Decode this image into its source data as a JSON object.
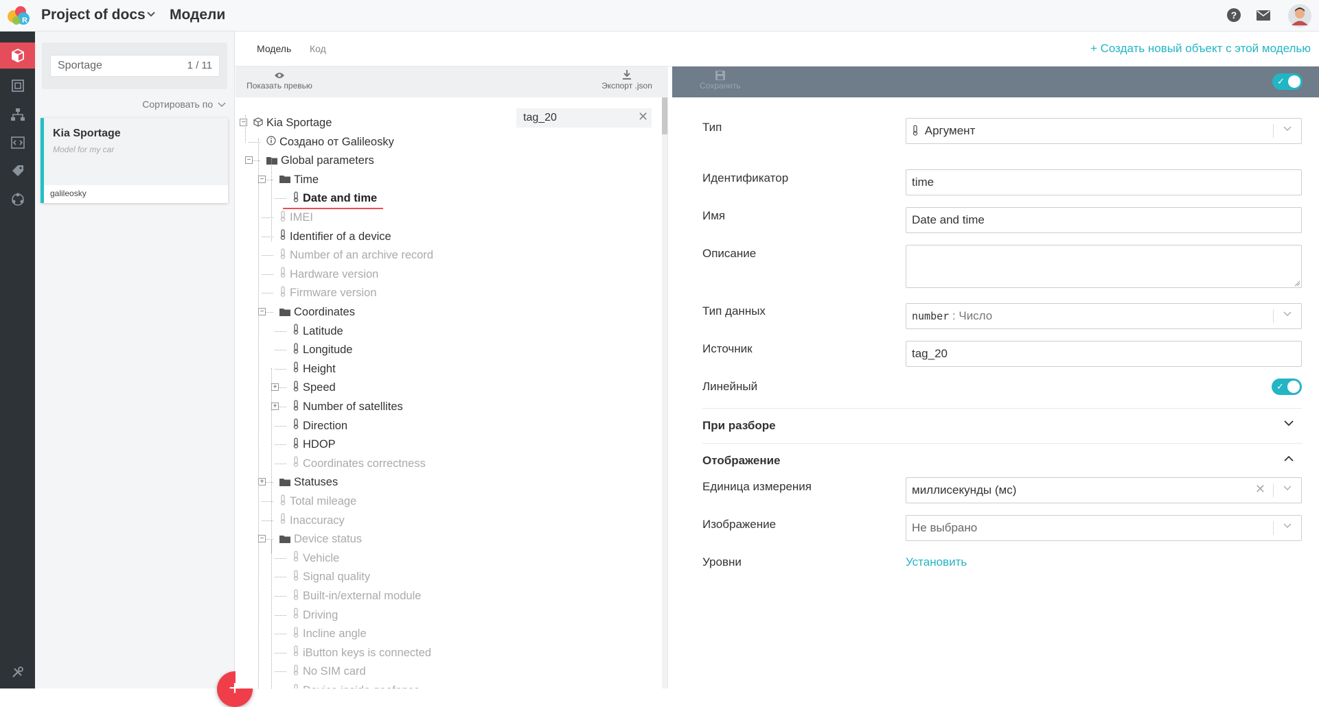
{
  "header": {
    "project_title": "Project of docs",
    "section_title": "Модели"
  },
  "list": {
    "search_value": "Sportage",
    "counter": "1 / 11",
    "sort_label": "Сортировать по",
    "cards": [
      {
        "title": "Kia Sportage",
        "description": "Model for my car",
        "owner": "galileosky"
      }
    ],
    "fab_label": "+"
  },
  "tabs": [
    {
      "label": "Модель",
      "active": true
    },
    {
      "label": "Код",
      "active": false
    }
  ],
  "create_link": "+ Создать новый объект с этой моделью",
  "tree_toolbar": {
    "preview_label": "Показать превью",
    "export_label": "Экспорт .json"
  },
  "tree_search": "tag_20",
  "tree": [
    {
      "label": "Kia Sportage",
      "icon": "cube-icon",
      "state": "on"
    },
    {
      "label": "Создано от Galileosky",
      "icon": "info-icon",
      "state": "on"
    },
    {
      "label": "Global parameters",
      "icon": "folder-icon",
      "state": "on"
    },
    {
      "label": "Time",
      "icon": "folder-icon",
      "state": "on"
    },
    {
      "label": "Date and time",
      "icon": "thermometer-icon",
      "state": "selected"
    },
    {
      "label": "IMEI",
      "icon": "thermometer-icon",
      "state": "off"
    },
    {
      "label": "Identifier of a device",
      "icon": "thermometer-icon",
      "state": "on"
    },
    {
      "label": "Number of an archive record",
      "icon": "thermometer-icon",
      "state": "off"
    },
    {
      "label": "Hardware version",
      "icon": "thermometer-icon",
      "state": "off"
    },
    {
      "label": "Firmware version",
      "icon": "thermometer-icon",
      "state": "off"
    },
    {
      "label": "Coordinates",
      "icon": "folder-icon",
      "state": "on"
    },
    {
      "label": "Latitude",
      "icon": "thermometer-icon",
      "state": "on"
    },
    {
      "label": "Longitude",
      "icon": "thermometer-icon",
      "state": "on"
    },
    {
      "label": "Height",
      "icon": "thermometer-icon",
      "state": "on"
    },
    {
      "label": "Speed",
      "icon": "thermometer-icon",
      "state": "on"
    },
    {
      "label": "Number of satellites",
      "icon": "thermometer-icon",
      "state": "on"
    },
    {
      "label": "Direction",
      "icon": "thermometer-icon",
      "state": "on"
    },
    {
      "label": "HDOP",
      "icon": "thermometer-icon",
      "state": "on"
    },
    {
      "label": "Coordinates correctness",
      "icon": "thermometer-icon",
      "state": "off"
    },
    {
      "label": "Statuses",
      "icon": "folder-icon",
      "state": "on"
    },
    {
      "label": "Total mileage",
      "icon": "thermometer-icon",
      "state": "off"
    },
    {
      "label": "Inaccuracy",
      "icon": "thermometer-icon",
      "state": "off"
    },
    {
      "label": "Device status",
      "icon": "folder-icon",
      "state": "off"
    },
    {
      "label": "Vehicle",
      "icon": "thermometer-icon",
      "state": "off"
    },
    {
      "label": "Signal quality",
      "icon": "thermometer-icon",
      "state": "off"
    },
    {
      "label": "Built-in/external module",
      "icon": "thermometer-icon",
      "state": "off"
    },
    {
      "label": "Driving",
      "icon": "thermometer-icon",
      "state": "off"
    },
    {
      "label": "Incline angle",
      "icon": "thermometer-icon",
      "state": "off"
    },
    {
      "label": "iButton keys is connected",
      "icon": "thermometer-icon",
      "state": "off"
    },
    {
      "label": "No SIM card",
      "icon": "thermometer-icon",
      "state": "off"
    },
    {
      "label": "Device inside geofence",
      "icon": "thermometer-icon",
      "state": "off"
    }
  ],
  "form": {
    "save_label": "Сохранить",
    "toggle_on": true,
    "type_label": "Тип",
    "type_value": "Аргумент",
    "id_label": "Идентификатор",
    "id_value": "time",
    "name_label": "Имя",
    "name_value": "Date and time",
    "desc_label": "Описание",
    "desc_value": "",
    "dtype_label": "Тип данных",
    "dtype_code": "number",
    "dtype_value": " : Число",
    "source_label": "Источник",
    "source_value": "tag_20",
    "linear_label": "Линейный",
    "linear_on": true,
    "parse_section": "При разборе",
    "display_section": "Отображение",
    "unit_label": "Единица измерения",
    "unit_value": "миллисекунды (мс)",
    "image_label": "Изображение",
    "image_value": "Не выбрано",
    "levels_label": "Уровни",
    "levels_link": "Установить"
  },
  "colors": {
    "accent": "#22b5c4",
    "danger": "#ef3e4a",
    "sidebar": "#2e3338",
    "sidebar_active": "#e54d5b"
  }
}
